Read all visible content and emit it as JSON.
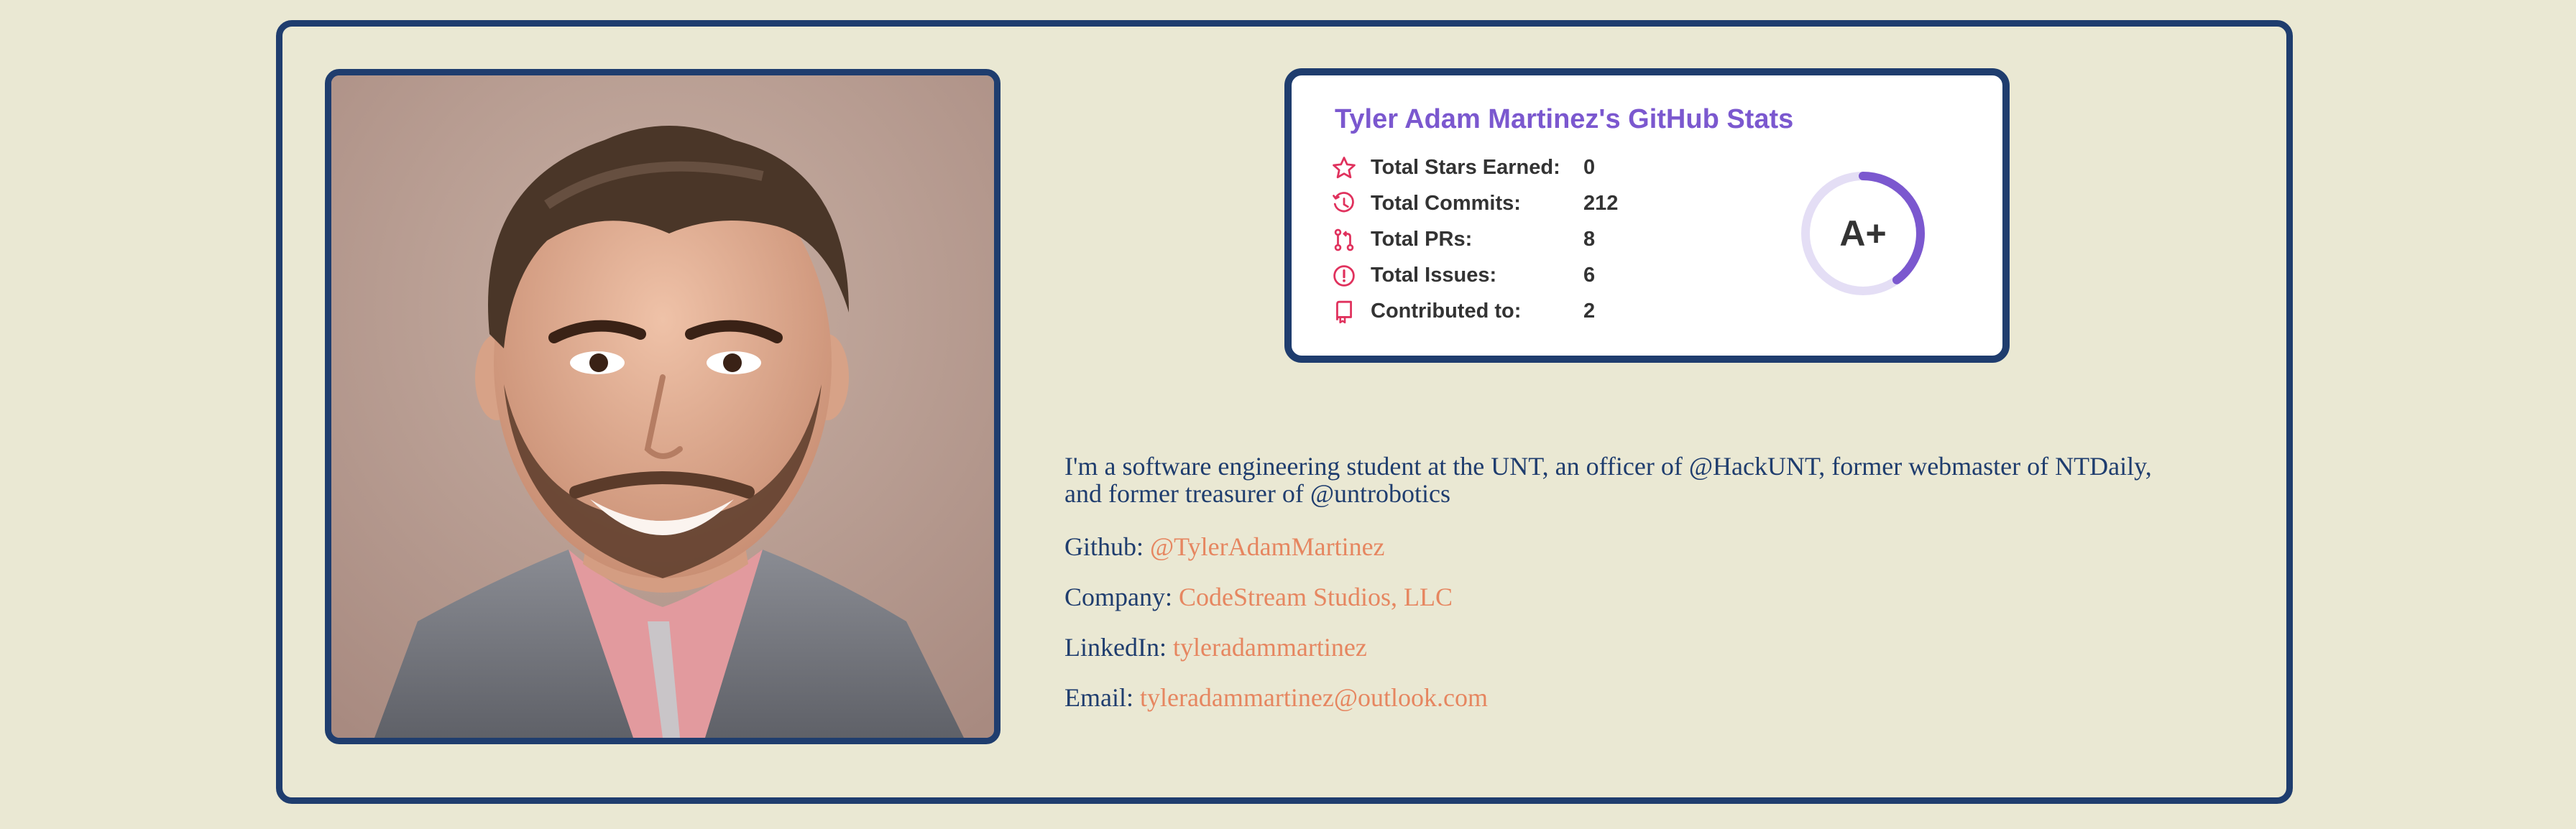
{
  "photo": {
    "alt": "Portrait photo"
  },
  "stats": {
    "title": "Tyler Adam Martinez's GitHub Stats",
    "rows": [
      {
        "icon": "star-icon",
        "label": "Total Stars Earned:",
        "value": "0"
      },
      {
        "icon": "history-icon",
        "label": "Total Commits:",
        "value": "212"
      },
      {
        "icon": "pull-request-icon",
        "label": "Total PRs:",
        "value": "8"
      },
      {
        "icon": "issue-icon",
        "label": "Total Issues:",
        "value": "6"
      },
      {
        "icon": "repo-icon",
        "label": "Contributed to:",
        "value": "2"
      }
    ],
    "rank": "A+",
    "rank_progress": 0.4,
    "colors": {
      "title": "#7b58cf",
      "icon": "#e0315d",
      "ring": "#7b58cf",
      "ring_track": "#e4def5"
    }
  },
  "profile": {
    "bio": "I'm a software engineering student at the UNT, an officer of @HackUNT, former webmaster of NTDaily, and former treasurer of @untrobotics",
    "github_label": "Github: ",
    "github_value": "@TylerAdamMartinez",
    "company_label": "Company: ",
    "company_value": "CodeStream Studios, LLC",
    "linkedin_label": "LinkedIn: ",
    "linkedin_value": "tyleradammartinez",
    "email_label": "Email: ",
    "email_value": "tyleradammartinez@outlook.com"
  },
  "colors": {
    "background": "#eae8d3",
    "border": "#1f3d6e",
    "text": "#1f3d6e",
    "link": "#e68660"
  }
}
